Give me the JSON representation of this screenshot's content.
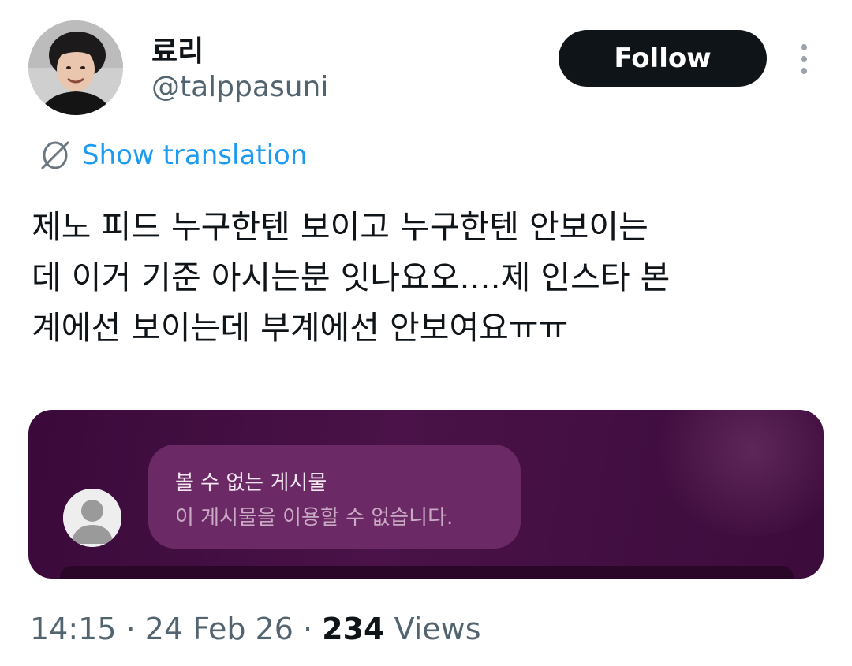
{
  "user": {
    "display_name": "료리",
    "handle": "@talppasuni"
  },
  "follow_label": "Follow",
  "translation_label": "Show translation",
  "tweet_lines": [
    "제노 피드 누구한텐 보이고 누구한텐 안보이는",
    "데 이거 기준 아시는분 잇나요오....제 인스타 본",
    "계에선 보이는데 부계에선 안보여요ㅠㅠ"
  ],
  "media": {
    "title": "볼 수 없는 게시물",
    "subtitle": "이 게시물을 이용할 수 없습니다."
  },
  "meta": {
    "time": "14:15",
    "sep1": " · ",
    "date": "24 Feb 26",
    "sep2": " · ",
    "views_count": "234",
    "views_label": " Views"
  },
  "colors": {
    "follow_bg": "#0f1419",
    "link_blue": "#1d9bf0",
    "secondary_text": "#536471",
    "media_bg": "#3a0a3a",
    "bubble_bg": "#6b2a66"
  }
}
